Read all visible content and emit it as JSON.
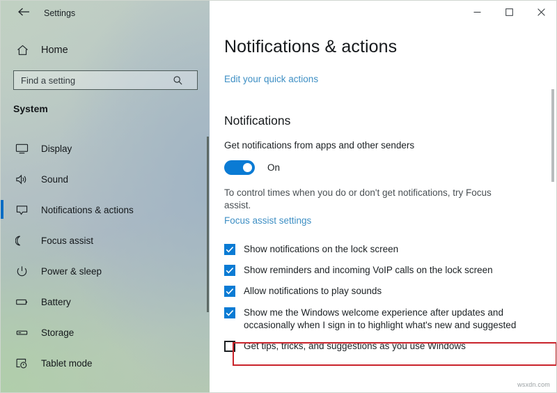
{
  "window": {
    "title": "Settings",
    "back_icon": "back-arrow-icon",
    "controls": {
      "minimize": "—",
      "maximize": "☐",
      "close": "✕"
    }
  },
  "sidebar": {
    "home_label": "Home",
    "home_icon": "home-icon",
    "search": {
      "placeholder": "Find a setting",
      "value": "",
      "icon": "search-icon"
    },
    "section_title": "System",
    "accent_color": "#0a6cc4",
    "items": [
      {
        "label": "Display",
        "icon": "monitor-icon",
        "selected": false
      },
      {
        "label": "Sound",
        "icon": "speaker-icon",
        "selected": false
      },
      {
        "label": "Notifications & actions",
        "icon": "notification-balloon-icon",
        "selected": true
      },
      {
        "label": "Focus assist",
        "icon": "moon-icon",
        "selected": false
      },
      {
        "label": "Power & sleep",
        "icon": "power-icon",
        "selected": false
      },
      {
        "label": "Battery",
        "icon": "battery-icon",
        "selected": false
      },
      {
        "label": "Storage",
        "icon": "storage-drive-icon",
        "selected": false
      },
      {
        "label": "Tablet mode",
        "icon": "tablet-touch-icon",
        "selected": false
      }
    ]
  },
  "main": {
    "page_title": "Notifications & actions",
    "quick_actions_link": "Edit your quick actions",
    "notifications_heading": "Notifications",
    "toggle_label": "Get notifications from apps and other senders",
    "toggle_state": "On",
    "toggle_on": true,
    "toggle_color": "#0a7bd4",
    "help_text": "To control times when you do or don't get notifications, try Focus assist.",
    "focus_assist_link": "Focus assist settings",
    "checkboxes": [
      {
        "label": "Show notifications on the lock screen",
        "checked": true
      },
      {
        "label": "Show reminders and incoming VoIP calls on the lock screen",
        "checked": true
      },
      {
        "label": "Allow notifications to play sounds",
        "checked": true
      },
      {
        "label": "Show me the Windows welcome experience after updates and occasionally when I sign in to highlight what's new and suggested",
        "checked": true
      },
      {
        "label": "Get tips, tricks, and suggestions as you use Windows",
        "checked": false
      }
    ],
    "highlight": {
      "target_index": 4,
      "color": "#c9232b"
    }
  },
  "watermark": "wsxdn.com"
}
